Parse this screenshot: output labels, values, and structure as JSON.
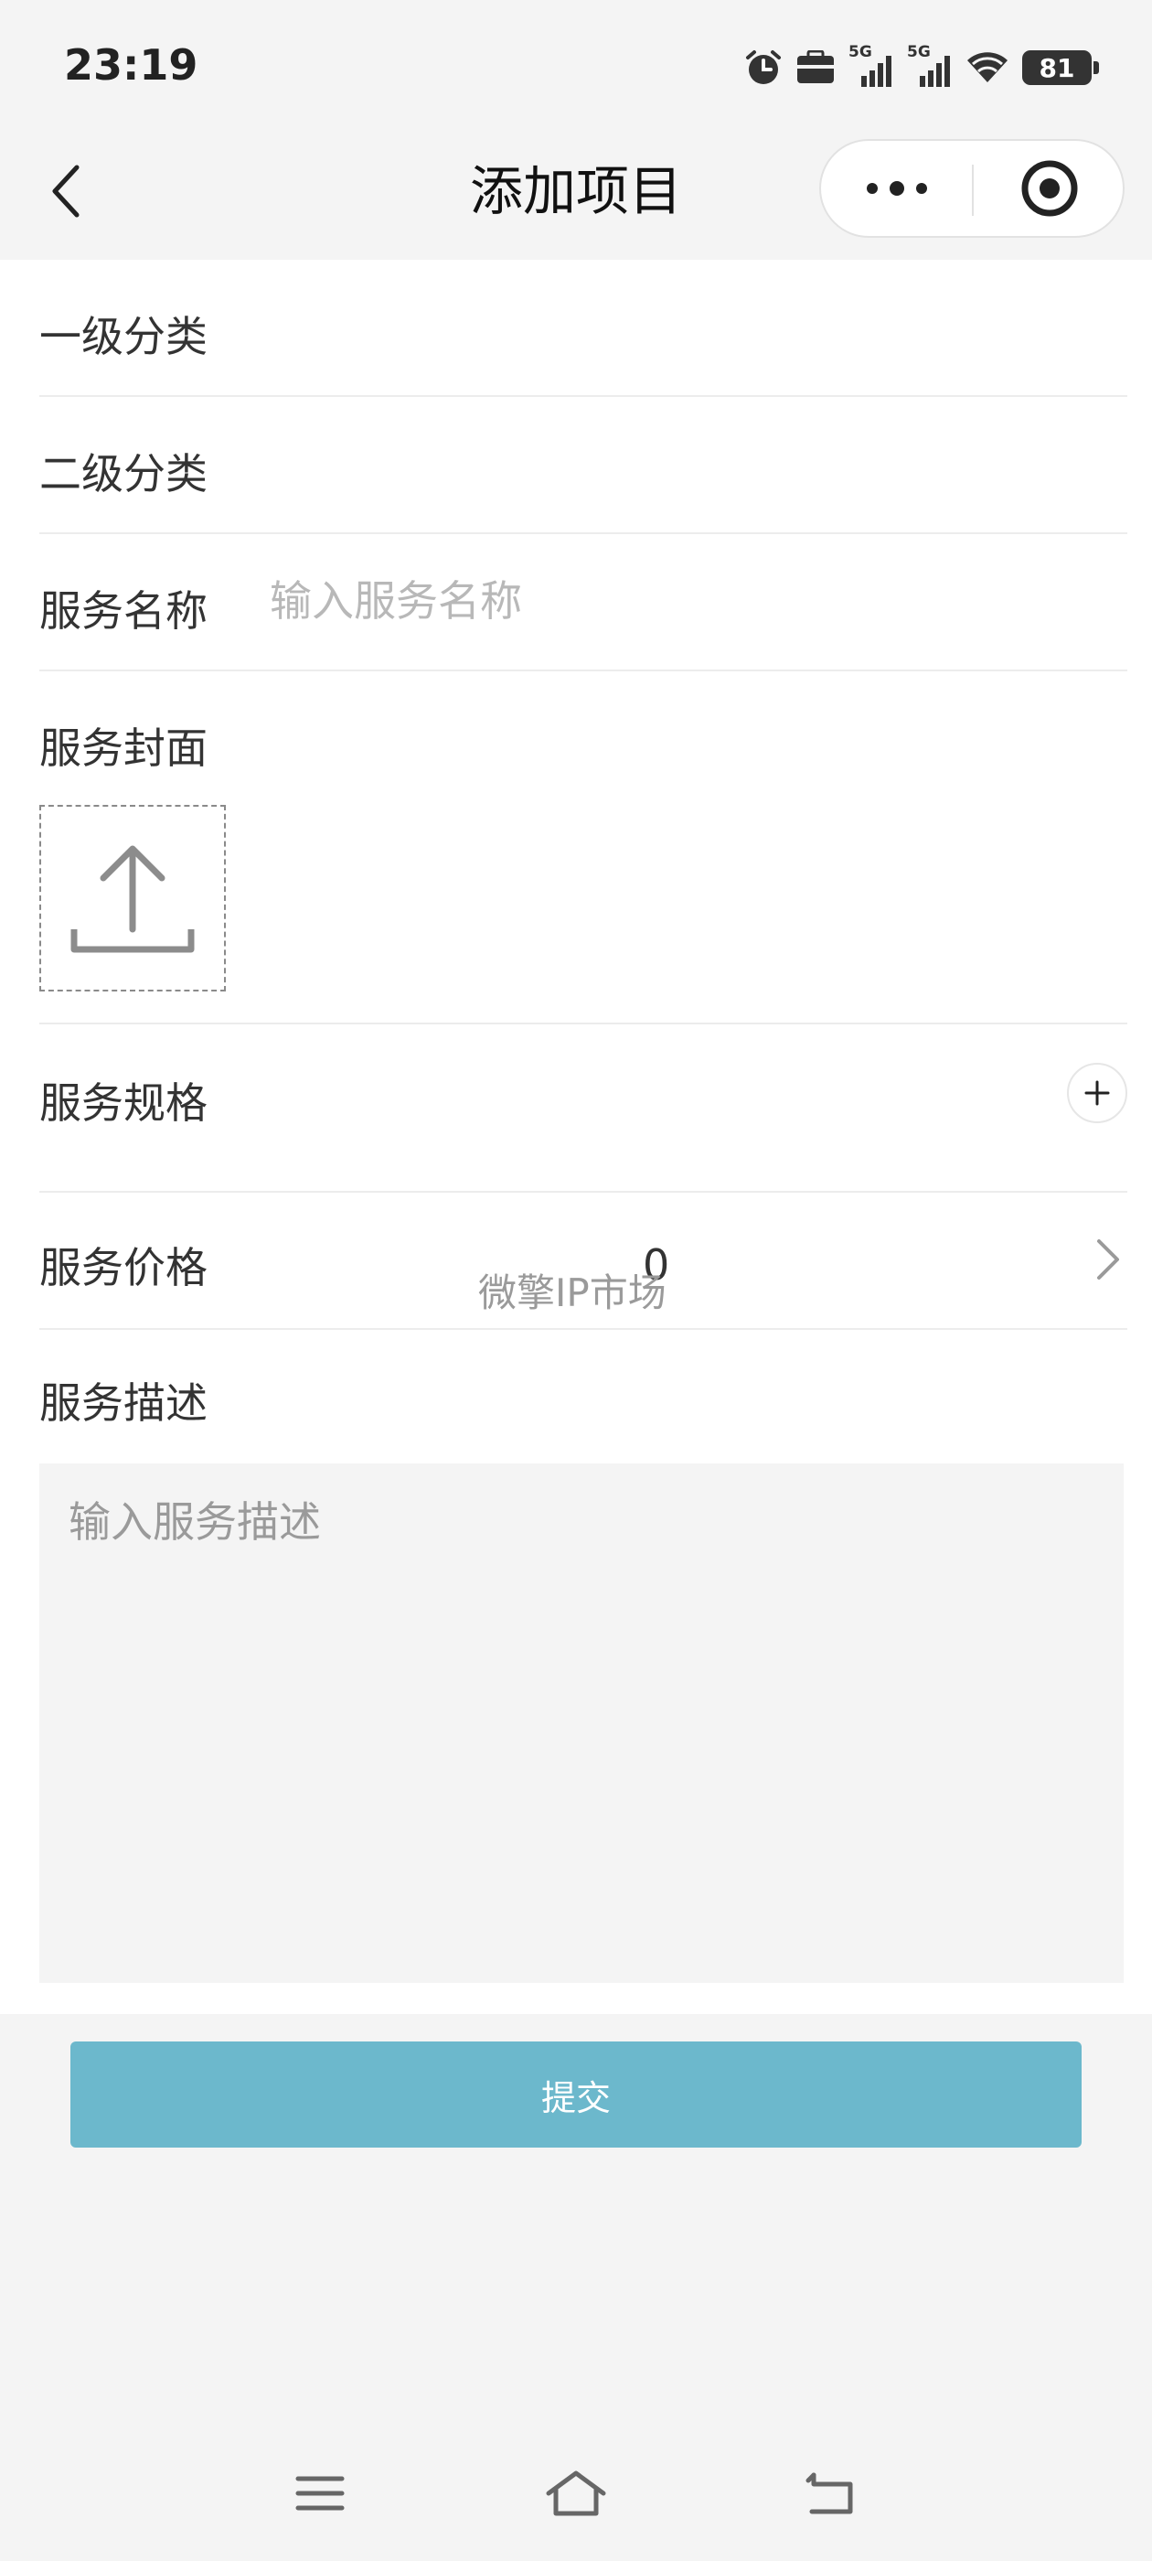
{
  "status_bar": {
    "time": "23:19",
    "network_1": "5G",
    "network_2": "5G",
    "battery": "81",
    "icons": [
      "alarm-icon",
      "bag-icon",
      "signal-icon",
      "signal-icon",
      "wifi-icon",
      "battery-icon"
    ]
  },
  "nav": {
    "title": "添加项目",
    "icons": [
      "back-chevron-icon",
      "more-dots-icon",
      "close-target-icon"
    ]
  },
  "form": {
    "category_1": {
      "label": "一级分类"
    },
    "category_2": {
      "label": "二级分类"
    },
    "service_name": {
      "label": "服务名称",
      "placeholder": "输入服务名称",
      "value": ""
    },
    "service_cover": {
      "label": "服务封面",
      "upload_icon": "upload-icon"
    },
    "service_spec": {
      "label": "服务规格",
      "add_icon": "plus-icon"
    },
    "service_price": {
      "label": "服务价格",
      "value": "0",
      "watermark": "微擎IP市场",
      "icon": "chevron-right-icon"
    },
    "service_desc": {
      "label": "服务描述",
      "placeholder": "输入服务描述",
      "value": ""
    }
  },
  "submit": {
    "label": "提交"
  },
  "colors": {
    "background": "#f4f4f4",
    "card": "#ffffff",
    "submit_button": "#6cb8cc",
    "placeholder": "#b8b8b8"
  },
  "system_nav": {
    "icons": [
      "menu-icon",
      "home-icon",
      "back-icon"
    ]
  }
}
